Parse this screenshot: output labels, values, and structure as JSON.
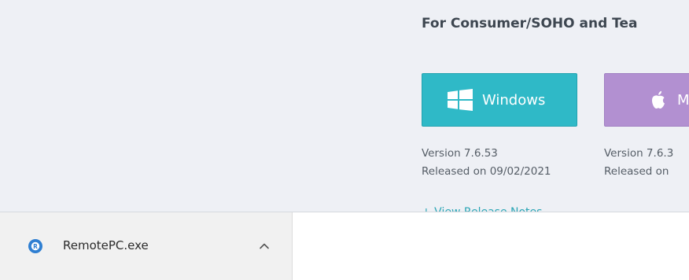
{
  "section": {
    "heading": "For Consumer/SOHO and Tea"
  },
  "downloads": {
    "windows": {
      "label": "Windows",
      "icon": "windows-logo-icon",
      "color": "#2fb9c7",
      "version": "Version 7.6.53",
      "released": "Released on 09/02/2021"
    },
    "mac": {
      "label": "M",
      "icon": "apple-logo-icon",
      "color": "#b290d1",
      "version": "Version 7.6.3",
      "released": "Released on"
    },
    "release_notes_link": "+ View Release Notes"
  },
  "download_bar": {
    "file_name": "RemotePC.exe",
    "file_icon": "remotepc-app-icon",
    "menu_icon": "chevron-up-icon"
  }
}
